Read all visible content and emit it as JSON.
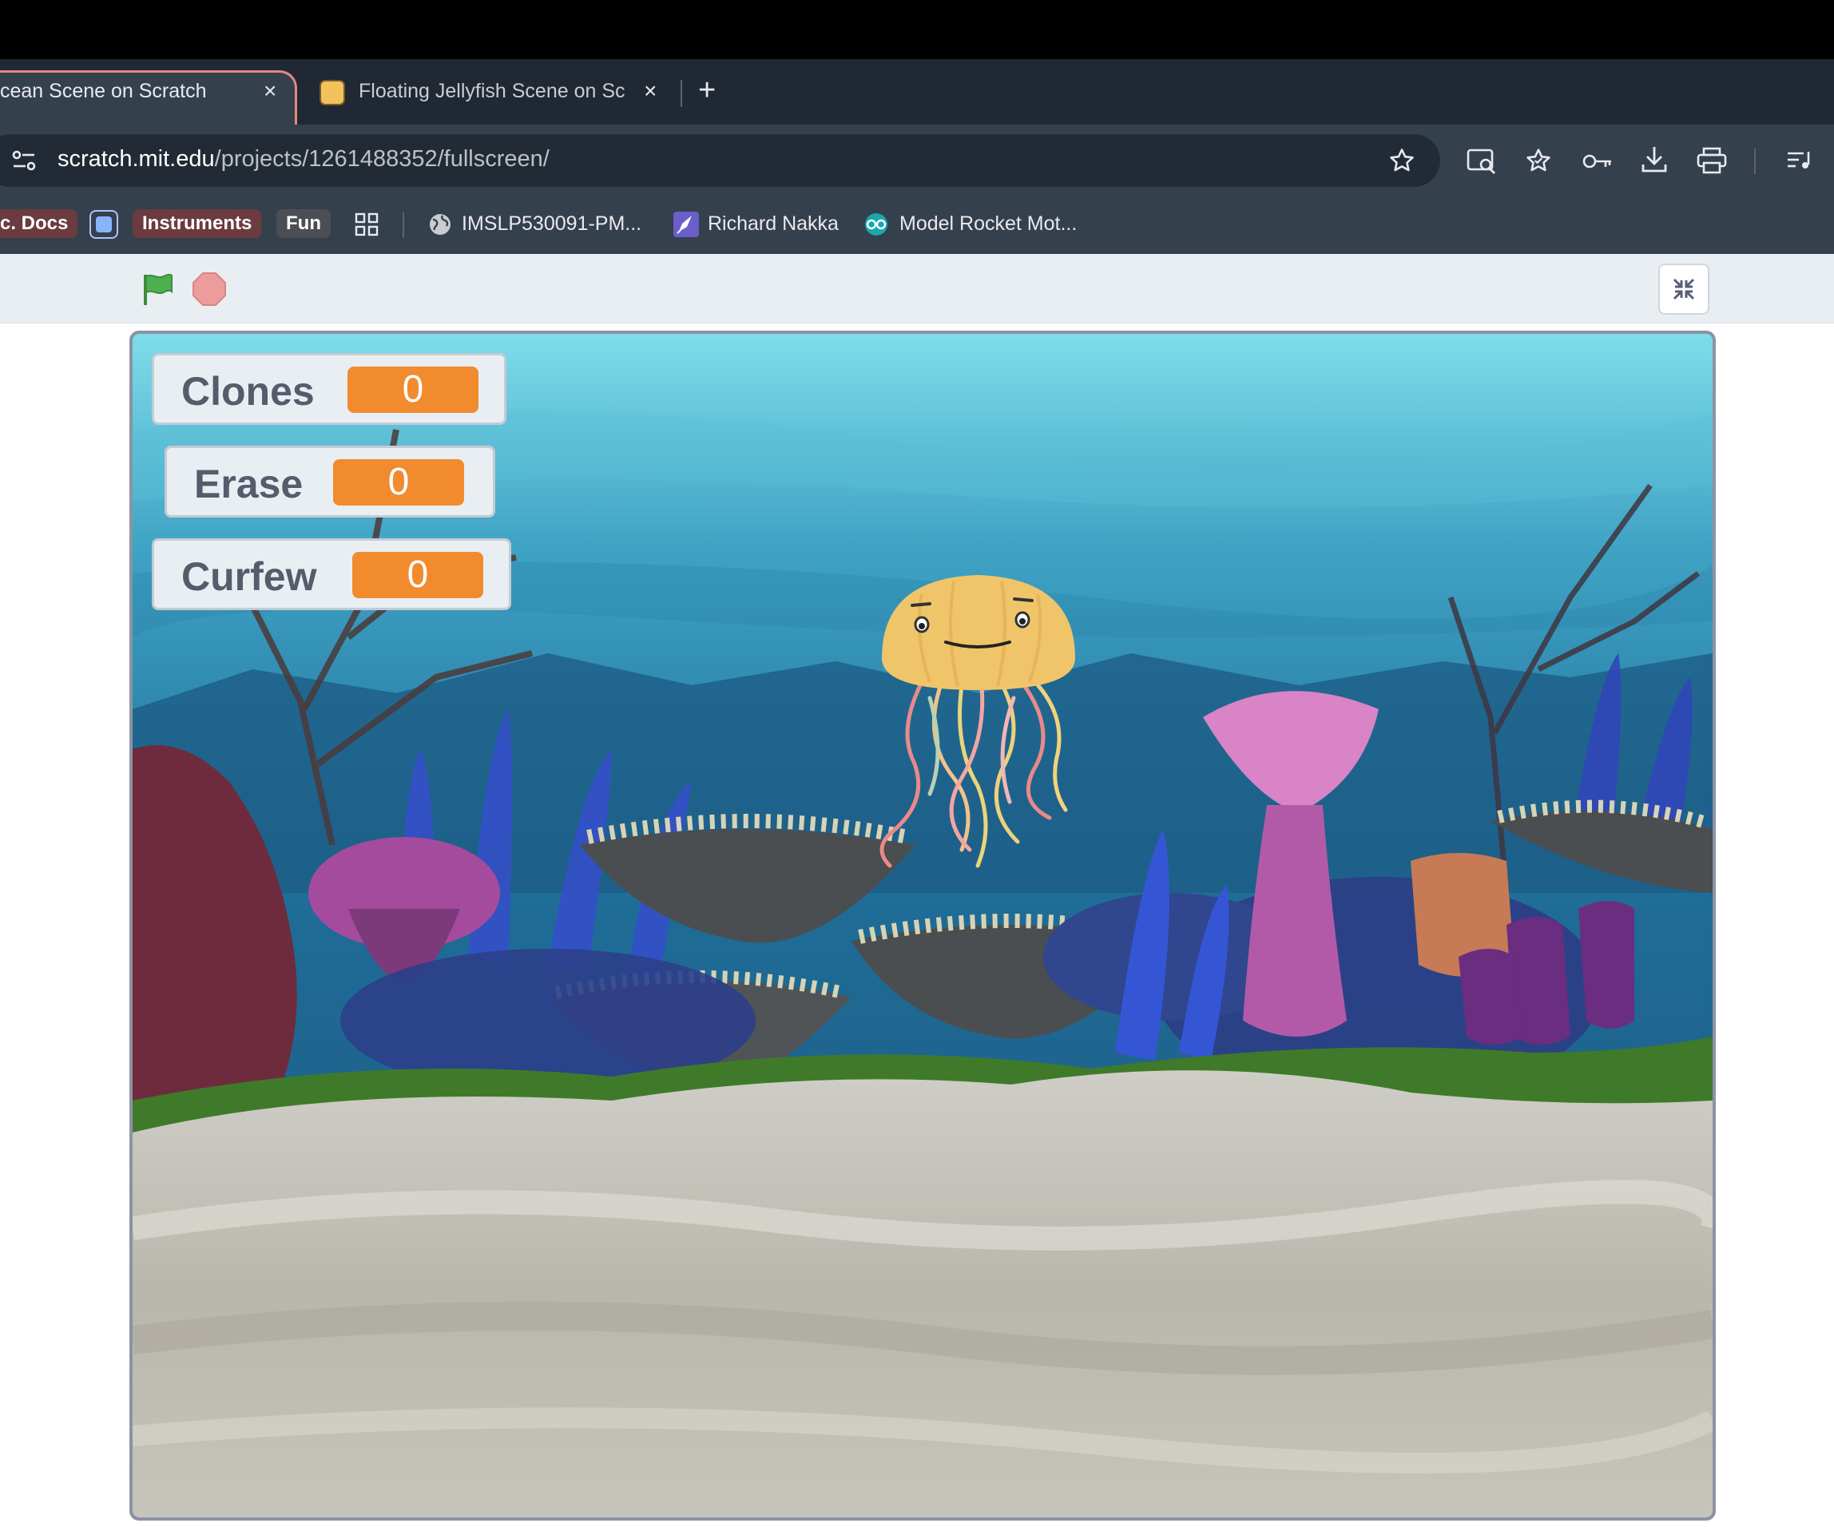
{
  "browser": {
    "tabs": [
      {
        "label": "cean Scene on Scratch",
        "active": true
      },
      {
        "label": "Floating Jellyfish Scene on Sc",
        "active": false
      }
    ],
    "new_tab_symbol": "+",
    "close_symbol": "×",
    "url_host": "scratch.mit.edu",
    "url_path": "/projects/1261488352/fullscreen/",
    "toolbar_icons": [
      "site-info-icon",
      "star-icon",
      "search-page-icon",
      "bookmark-star-icon",
      "password-key-icon",
      "download-icon",
      "print-icon",
      "reading-list-icon"
    ]
  },
  "bookmarks": {
    "chips": [
      {
        "label": "c. Docs",
        "color": "#6b3b3f"
      },
      {
        "label": "Instruments",
        "color": "#6b3b3f"
      },
      {
        "label": "Fun",
        "color": "#4b4f54"
      }
    ],
    "links": [
      {
        "label": "IMSLP530091-PM...",
        "icon": "globe-icon"
      },
      {
        "label": "Richard Nakka",
        "icon": "rocket-icon"
      },
      {
        "label": "Model Rocket Mot...",
        "icon": "arduino-icon"
      }
    ]
  },
  "controls": {
    "green_flag": "green-flag-icon",
    "stop": "stop-icon",
    "exit_fullscreen": "unfullscreen-icon",
    "flag_color": "#4cb050",
    "stop_color": "#ec9c9a"
  },
  "monitors": [
    {
      "label": "Clones",
      "value": "0"
    },
    {
      "label": "Erase",
      "value": "0"
    },
    {
      "label": "Curfew",
      "value": "0"
    }
  ],
  "stage": {
    "sprite": "jellyfish",
    "backdrop": "underwater-reef",
    "monitor_accent": "#f28a2e"
  }
}
